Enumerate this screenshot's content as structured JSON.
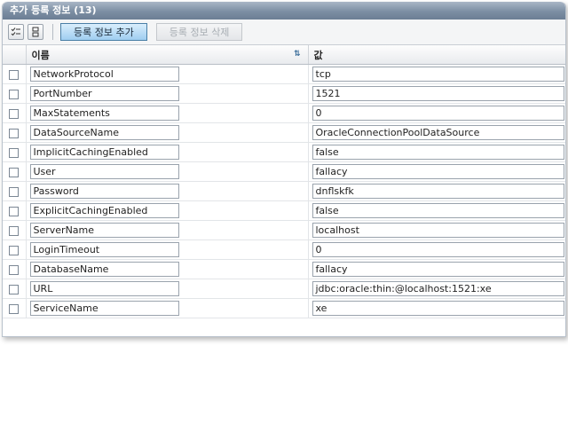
{
  "panel": {
    "title": "추가 등록 정보 (13)"
  },
  "toolbar": {
    "select_all_icon": "check-list-icon",
    "clear_icon": "uncheck-list-icon",
    "add_label": "등록 정보 추가",
    "delete_label": "등록 정보 삭제"
  },
  "table": {
    "columns": {
      "name": "이름",
      "value": "값"
    },
    "rows": [
      {
        "name": "NetworkProtocol",
        "value": "tcp"
      },
      {
        "name": "PortNumber",
        "value": "1521"
      },
      {
        "name": "MaxStatements",
        "value": "0"
      },
      {
        "name": "DataSourceName",
        "value": "OracleConnectionPoolDataSource"
      },
      {
        "name": "ImplicitCachingEnabled",
        "value": "false"
      },
      {
        "name": "User",
        "value": "fallacy"
      },
      {
        "name": "Password",
        "value": "dnflskfk"
      },
      {
        "name": "ExplicitCachingEnabled",
        "value": "false"
      },
      {
        "name": "ServerName",
        "value": "localhost"
      },
      {
        "name": "LoginTimeout",
        "value": "0"
      },
      {
        "name": "DatabaseName",
        "value": "fallacy"
      },
      {
        "name": "URL",
        "value": "jdbc:oracle:thin:@localhost:1521:xe"
      },
      {
        "name": "ServiceName",
        "value": "xe"
      }
    ]
  },
  "colors": {
    "title_bar": "#7c8ea3",
    "add_button": "#9fcdf0",
    "border": "#9aa3ad"
  }
}
